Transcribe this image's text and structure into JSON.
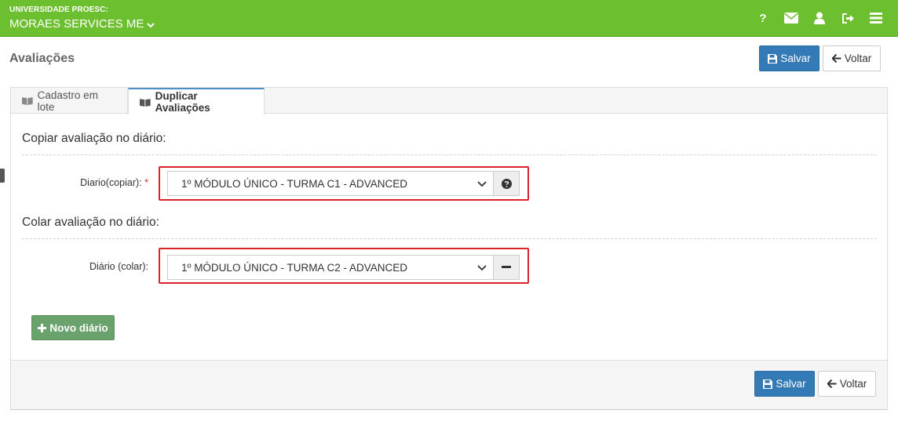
{
  "header": {
    "institution": "UNIVERSIDADE PROESC:",
    "company": "MORAES SERVICES ME",
    "icons": [
      "question-icon",
      "envelope-icon",
      "user-icon",
      "sign-out-icon",
      "menu-icon"
    ],
    "help_glyph": "?"
  },
  "page": {
    "title": "Avaliações"
  },
  "top_actions": {
    "save_label": "Salvar",
    "back_label": "Voltar"
  },
  "tabs": [
    {
      "label": "Cadastro em lote",
      "active": false
    },
    {
      "label": "Duplicar Avaliações",
      "active": true
    }
  ],
  "copy_section": {
    "title": "Copiar avaliação no diário:",
    "field_label": "Diario(copiar):",
    "required_mark": "*",
    "selected": "1º MÓDULO ÚNICO - TURMA C1 - ADVANCED",
    "addon_icon": "question-circle-icon"
  },
  "paste_section": {
    "title": "Colar avaliação no diário:",
    "field_label": "Diário (colar):",
    "selected": "1º MÓDULO ÚNICO - TURMA C2 - ADVANCED",
    "addon_icon": "minus-icon"
  },
  "new_diary_button": {
    "label": "Novo diário"
  },
  "footer_actions": {
    "save_label": "Salvar",
    "back_label": "Voltar"
  },
  "colors": {
    "topbar": "#6cbf2f",
    "primary": "#337ab7",
    "success": "#6aa26e",
    "highlight": "#d9222a"
  }
}
